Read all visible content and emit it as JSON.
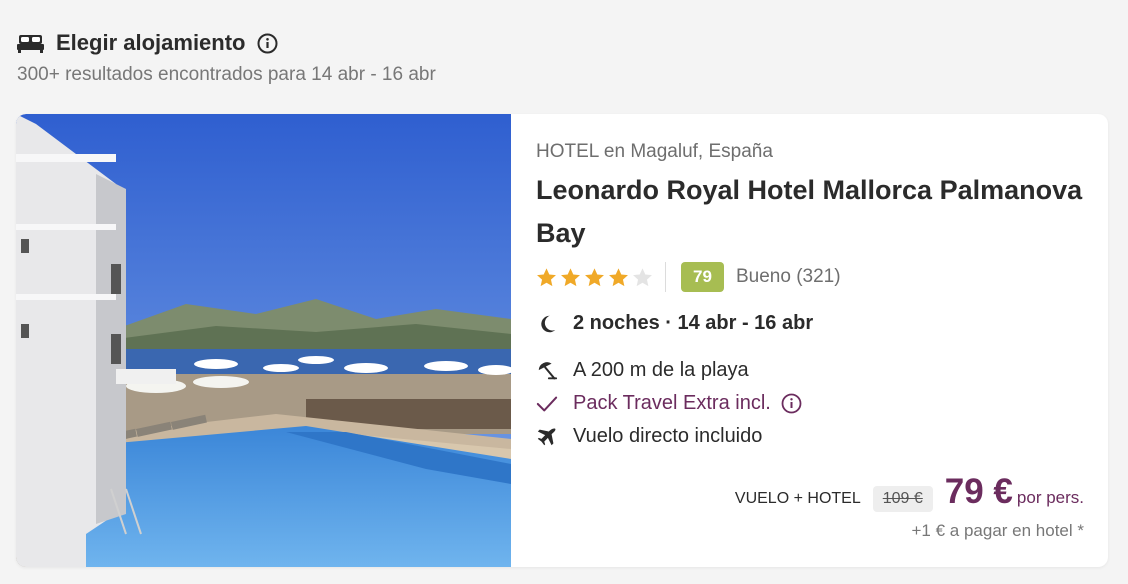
{
  "header": {
    "title": "Elegir alojamiento",
    "subtitle": "300+ resultados encontrados para 14 abr - 16 abr",
    "icons": [
      "bed-icon",
      "info-icon"
    ]
  },
  "hotel": {
    "type_location": "HOTEL en Magaluf, España",
    "name": "Leonardo Royal Hotel Mallorca Palmanova Bay",
    "stars": 4,
    "stars_max": 5,
    "score": "79",
    "score_label": "Bueno (321)",
    "nights": "2 noches · 14 abr - 16 abr",
    "features": [
      {
        "icon": "beach-umbrella-icon",
        "label": "A 200 m de la playa"
      },
      {
        "icon": "checkmark-icon",
        "label": "Pack Travel Extra incl."
      },
      {
        "icon": "airplane-icon",
        "label": "Vuelo directo incluido"
      }
    ]
  },
  "price": {
    "type_label": "VUELO + HOTEL",
    "old_price": "109 €",
    "current_price": "79 €",
    "per_label": "por pers.",
    "extra_note": "+1 € a pagar en hotel *"
  },
  "colors": {
    "accent": "#6b2c5e",
    "star": "#f0a928",
    "score_badge": "#a7bd52",
    "background": "#f4f4f4"
  }
}
